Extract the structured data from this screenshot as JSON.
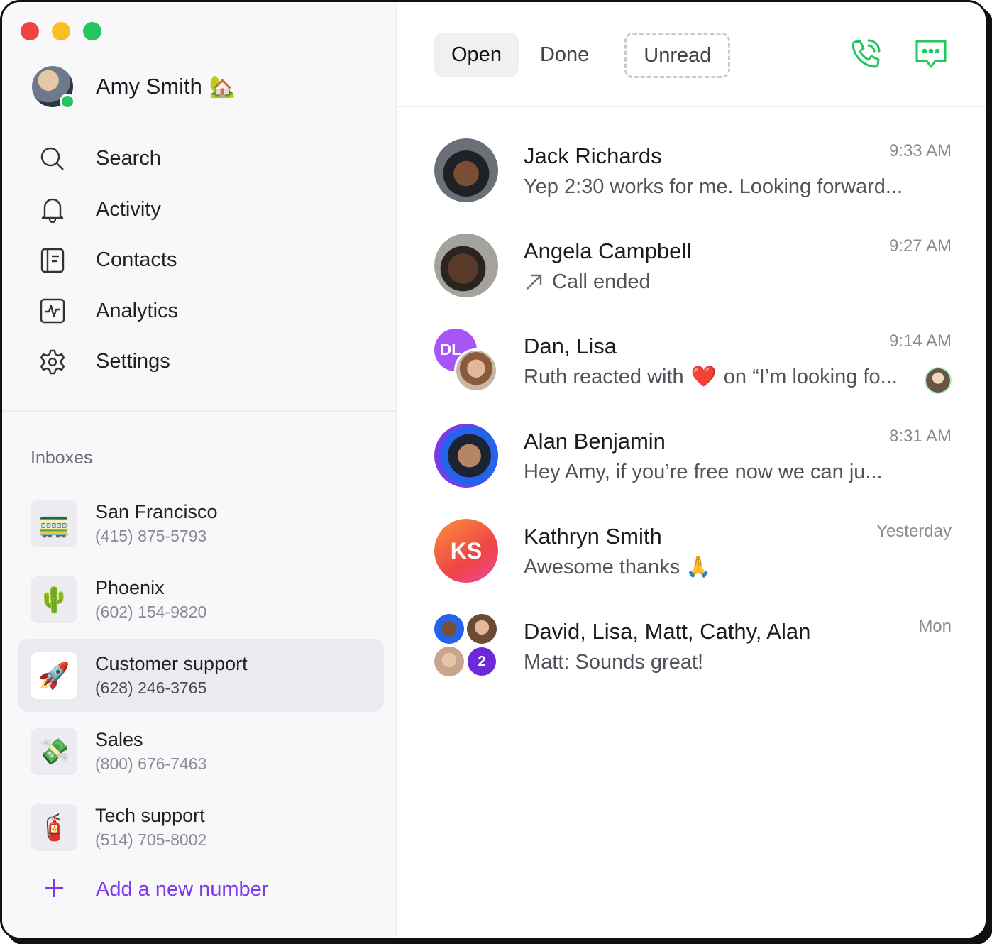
{
  "window": {
    "traffic_lights": [
      "#ef4444",
      "#fbbf24",
      "#22c55e"
    ]
  },
  "profile": {
    "name": "Amy Smith",
    "status_emoji": "🏡",
    "online": true
  },
  "nav": {
    "items": [
      {
        "label": "Search",
        "icon": "search-icon"
      },
      {
        "label": "Activity",
        "icon": "bell-icon"
      },
      {
        "label": "Contacts",
        "icon": "contacts-book-icon"
      },
      {
        "label": "Analytics",
        "icon": "analytics-icon"
      },
      {
        "label": "Settings",
        "icon": "gear-icon"
      }
    ]
  },
  "inboxes": {
    "heading": "Inboxes",
    "items": [
      {
        "emoji": "🚃",
        "name": "San Francisco",
        "phone": "(415) 875-5793",
        "active": false
      },
      {
        "emoji": "🌵",
        "name": "Phoenix",
        "phone": "(602) 154-9820",
        "active": false
      },
      {
        "emoji": "🚀",
        "name": "Customer support",
        "phone": "(628) 246-3765",
        "active": true
      },
      {
        "emoji": "💸",
        "name": "Sales",
        "phone": "(800) 676-7463",
        "active": false
      },
      {
        "emoji": "🧯",
        "name": "Tech support",
        "phone": "(514) 705-8002",
        "active": false
      }
    ],
    "add_label": "Add a new number"
  },
  "tabs": [
    {
      "label": "Open",
      "active": true
    },
    {
      "label": "Done",
      "active": false
    },
    {
      "label": "Unread",
      "active": false
    }
  ],
  "toolbar": {
    "call_icon": "phone-icon",
    "message_icon": "chat-bubble-icon",
    "accent": "#22c55e"
  },
  "conversations": [
    {
      "name": "Jack Richards",
      "time": "9:33 AM",
      "preview": "Yep 2:30 works for me. Looking forward..."
    },
    {
      "name": "Angela Campbell",
      "time": "9:27 AM",
      "preview": "Call ended"
    },
    {
      "name": "Dan, Lisa",
      "time": "9:14 AM",
      "preview_before": "Ruth reacted with",
      "preview_emoji": "❤️",
      "preview_after": "on “I’m looking fo...",
      "initials": "DL"
    },
    {
      "name": "Alan Benjamin",
      "time": "8:31 AM",
      "preview": "Hey Amy, if you’re free now we can ju..."
    },
    {
      "name": "Kathryn Smith",
      "time": "Yesterday",
      "preview": "Awesome thanks 🙏",
      "initials": "KS"
    },
    {
      "name": "David, Lisa, Matt, Cathy, Alan",
      "time": "Mon",
      "preview": "Matt: Sounds great!",
      "extra_count": "2"
    }
  ]
}
